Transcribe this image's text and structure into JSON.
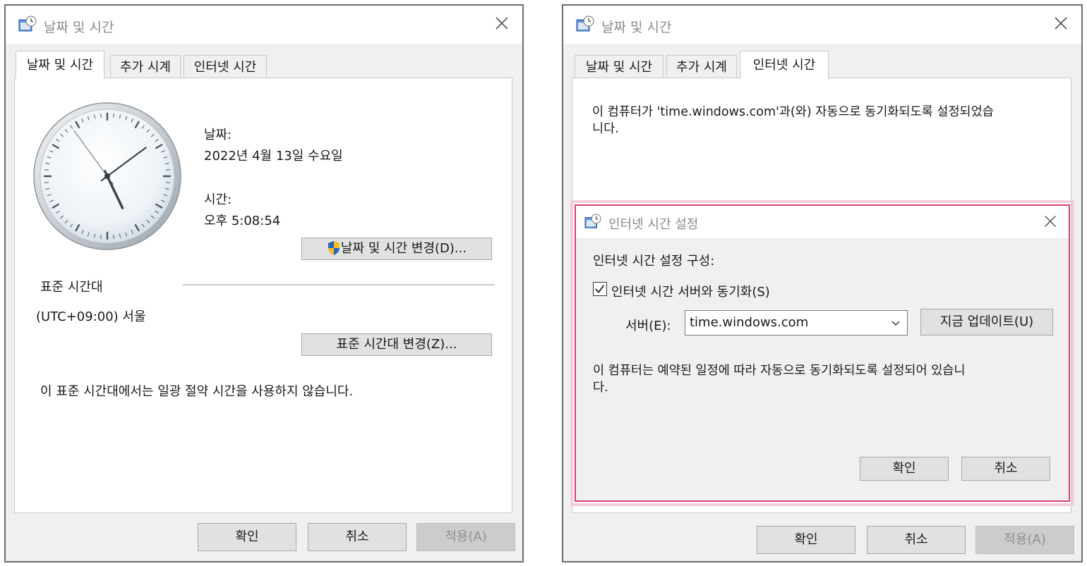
{
  "left_dialog": {
    "title": "날짜 및 시간",
    "tabs": [
      "날짜 및 시간",
      "추가 시계",
      "인터넷 시간"
    ],
    "date_label": "날짜:",
    "date_value": "2022년 4월 13일 수요일",
    "time_label": "시간:",
    "time_value": "오후 5:08:54",
    "change_datetime_button": "날짜 및 시간 변경(D)...",
    "timezone_heading": "표준 시간대",
    "timezone_value": "(UTC+09:00) 서울",
    "change_timezone_button": "표준 시간대 변경(Z)...",
    "dst_note": "이 표준 시간대에서는 일광 절약 시간을 사용하지 않습니다.",
    "ok_button": "확인",
    "cancel_button": "취소",
    "apply_button": "적용(A)"
  },
  "right_dialog": {
    "title": "날짜 및 시간",
    "tabs": [
      "날짜 및 시간",
      "추가 시계",
      "인터넷 시간"
    ],
    "sync_message_line1": "이 컴퓨터가 'time.windows.com'과(와) 자동으로 동기화되도록 설정되었습",
    "sync_message_line2": "니다.",
    "ok_button": "확인",
    "cancel_button": "취소",
    "apply_button": "적용(A)"
  },
  "inner_dialog": {
    "title": "인터넷 시간 설정",
    "config_label": "인터넷 시간 설정 구성:",
    "sync_checkbox_label": "인터넷 시간 서버와 동기화(S)",
    "sync_checked": true,
    "server_label": "서버(E):",
    "server_value": "time.windows.com",
    "update_now_button": "지금 업데이트(U)",
    "schedule_message_line1": "이 컴퓨터는 예약된 일정에 따라 자동으로 동기화되도록 설정되어 있습니",
    "schedule_message_line2": "다.",
    "ok_button": "확인",
    "cancel_button": "취소"
  },
  "clock": {
    "hours": 5,
    "minutes": 8,
    "seconds": 54
  },
  "colors": {
    "highlight_border": "#d6406f",
    "window_border": "#6e6e6e",
    "dialog_bg": "#f0f0f0"
  }
}
